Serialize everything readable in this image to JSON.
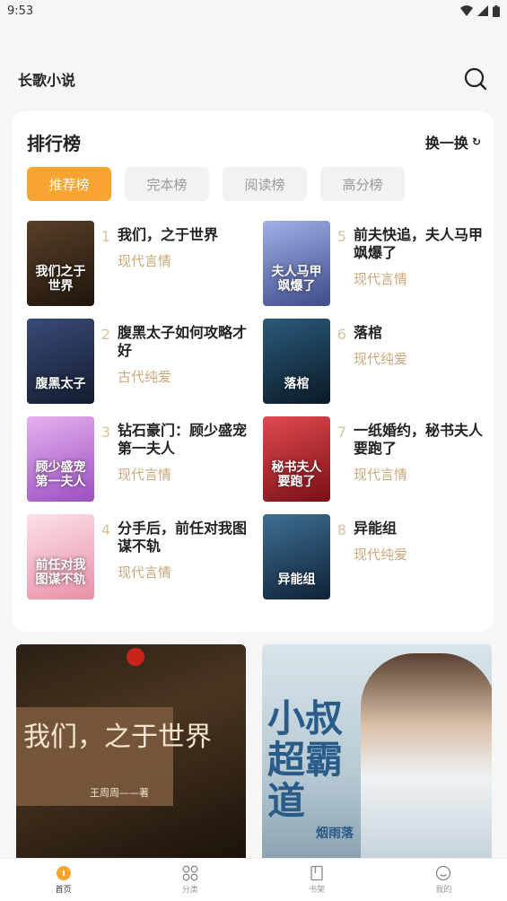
{
  "status_bar": {
    "time": "9:53"
  },
  "header": {
    "title": "长歌小说"
  },
  "ranking": {
    "title": "排行榜",
    "refresh_label": "换一换",
    "refresh_icon": "↻",
    "tabs": [
      {
        "label": "推荐榜",
        "active": true
      },
      {
        "label": "完本榜",
        "active": false
      },
      {
        "label": "阅读榜",
        "active": false
      },
      {
        "label": "高分榜",
        "active": false
      }
    ],
    "books": [
      {
        "rank": "1",
        "title": "我们，之于世界",
        "category": "现代言情",
        "cover_text": "我们之于世界",
        "cover_color": "#3a2a1a"
      },
      {
        "rank": "2",
        "title": "腹黑太子如何攻略才好",
        "category": "古代纯爱",
        "cover_text": "腹黑太子",
        "cover_color": "#1e2a44"
      },
      {
        "rank": "3",
        "title": "钻石豪门：顾少盛宠第一夫人",
        "category": "现代言情",
        "cover_text": "顾少盛宠第一夫人",
        "cover_color": "#c77bd6"
      },
      {
        "rank": "4",
        "title": "分手后，前任对我图谋不轨",
        "category": "现代言情",
        "cover_text": "前任对我图谋不轨",
        "cover_color": "#f2b7c3"
      },
      {
        "rank": "5",
        "title": "前夫快追，夫人马甲飒爆了",
        "category": "现代言情",
        "cover_text": "夫人马甲飒爆了",
        "cover_color": "#4f5f9c"
      },
      {
        "rank": "6",
        "title": "落棺",
        "category": "现代纯爱",
        "cover_text": "落棺",
        "cover_color": "#13314a"
      },
      {
        "rank": "7",
        "title": "一纸婚约，秘书夫人要跑了",
        "category": "现代言情",
        "cover_text": "秘书夫人要跑了",
        "cover_color": "#b0222c"
      },
      {
        "rank": "8",
        "title": "异能组",
        "category": "现代纯爱",
        "cover_text": "异能组",
        "cover_color": "#1d3a5a"
      }
    ]
  },
  "banners": [
    {
      "title": "我们，之于世界",
      "author": "王周周——著"
    },
    {
      "title": "小叔超霸道",
      "author": "烟雨落"
    }
  ],
  "bottom_nav": [
    {
      "label": "首页",
      "icon": "home-icon",
      "active": true
    },
    {
      "label": "分类",
      "icon": "category-icon",
      "active": false
    },
    {
      "label": "书架",
      "icon": "bookshelf-icon",
      "active": false
    },
    {
      "label": "我的",
      "icon": "profile-icon",
      "active": false
    }
  ],
  "colors": {
    "accent": "#f7a530",
    "category_text": "#c9a97a",
    "rank_number": "#d8c29a"
  }
}
